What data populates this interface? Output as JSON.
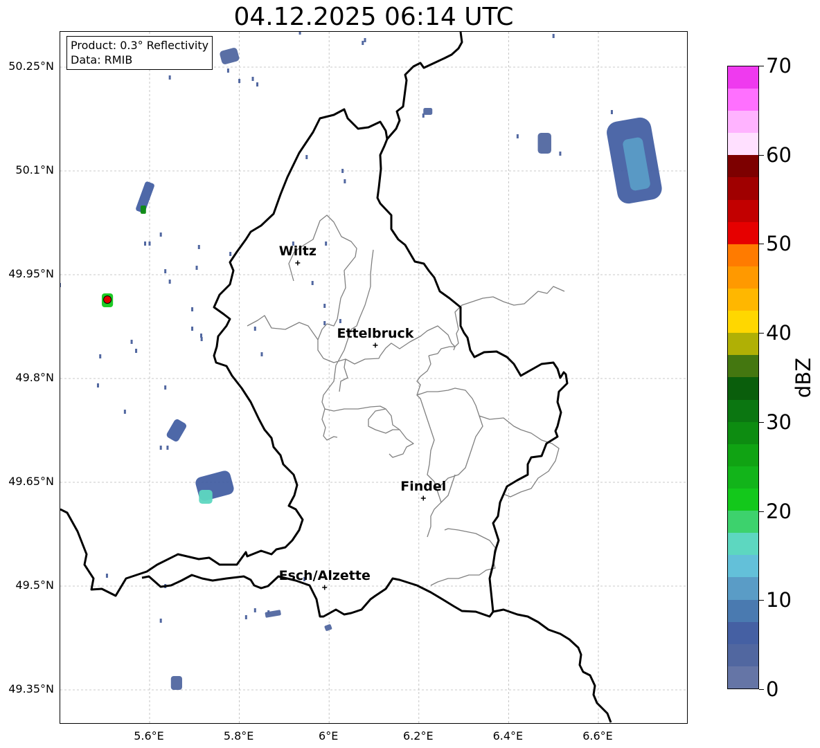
{
  "title": "04.12.2025 06:14 UTC",
  "info": {
    "product": "Product: 0.3° Reflectivity",
    "data": "Data: RMIB"
  },
  "lat_ticks": [
    {
      "value": 50.25,
      "label": "50.25°N"
    },
    {
      "value": 50.1,
      "label": "50.1°N"
    },
    {
      "value": 49.95,
      "label": "49.95°N"
    },
    {
      "value": 49.8,
      "label": "49.8°N"
    },
    {
      "value": 49.65,
      "label": "49.65°N"
    },
    {
      "value": 49.5,
      "label": "49.5°N"
    },
    {
      "value": 49.35,
      "label": "49.35°N"
    }
  ],
  "lon_ticks": [
    {
      "value": 5.6,
      "label": "5.6°E"
    },
    {
      "value": 5.8,
      "label": "5.8°E"
    },
    {
      "value": 6.0,
      "label": "6°E"
    },
    {
      "value": 6.2,
      "label": "6.2°E"
    },
    {
      "value": 6.4,
      "label": "6.4°E"
    },
    {
      "value": 6.6,
      "label": "6.6°E"
    }
  ],
  "cities": [
    {
      "name": "Wiltz",
      "lon": 5.93,
      "lat": 49.967
    },
    {
      "name": "Ettelbruck",
      "lon": 6.103,
      "lat": 49.848
    },
    {
      "name": "Findel",
      "lon": 6.21,
      "lat": 49.627
    },
    {
      "name": "Esch/Alzette",
      "lon": 5.99,
      "lat": 49.498
    }
  ],
  "radar_site": {
    "lon": 5.506,
    "lat": 49.914
  },
  "colorbar": {
    "unit": "dBZ",
    "min": 0,
    "max": 70,
    "ticks": [
      {
        "value": 0,
        "label": "0"
      },
      {
        "value": 10,
        "label": "10"
      },
      {
        "value": 20,
        "label": "20"
      },
      {
        "value": 30,
        "label": "30"
      },
      {
        "value": 40,
        "label": "40"
      },
      {
        "value": 50,
        "label": "50"
      },
      {
        "value": 60,
        "label": "60"
      },
      {
        "value": 70,
        "label": "70"
      }
    ],
    "colors": [
      "#6575a6",
      "#5167a0",
      "#4560a3",
      "#4a7ab0",
      "#5a9cc6",
      "#63c0d9",
      "#5dd7c0",
      "#3dd26d",
      "#13c81b",
      "#12b41a",
      "#10a313",
      "#0d8c11",
      "#0b7611",
      "#0a5e0c",
      "#447710",
      "#b0b005",
      "#ffd700",
      "#ffb700",
      "#ff9900",
      "#ff7b00",
      "#e60000",
      "#c20000",
      "#a00000",
      "#7d0000",
      "#ffe0ff",
      "#ffb3ff",
      "#ff70ff",
      "#ef3aef"
    ]
  },
  "echoes": [
    {
      "lon": 6.68,
      "lat": 50.115,
      "w": 0.1,
      "h": 0.12,
      "rot": -10,
      "dbz": 6
    },
    {
      "lon": 6.685,
      "lat": 50.11,
      "w": 0.045,
      "h": 0.075,
      "rot": -10,
      "dbz": 12
    },
    {
      "lon": 6.48,
      "lat": 50.14,
      "w": 0.03,
      "h": 0.03,
      "rot": 0,
      "dbz": 3
    },
    {
      "lon": 5.778,
      "lat": 50.266,
      "w": 0.04,
      "h": 0.02,
      "rot": -15,
      "dbz": 3
    },
    {
      "lon": 5.59,
      "lat": 50.062,
      "w": 0.022,
      "h": 0.045,
      "rot": 20,
      "dbz": 6
    },
    {
      "lon": 5.586,
      "lat": 50.044,
      "w": 0.012,
      "h": 0.012,
      "rot": 0,
      "dbz": 28
    },
    {
      "lon": 5.506,
      "lat": 49.913,
      "w": 0.025,
      "h": 0.02,
      "rot": 0,
      "dbz": 20
    },
    {
      "lon": 5.66,
      "lat": 49.725,
      "w": 0.03,
      "h": 0.03,
      "rot": 30,
      "dbz": 5
    },
    {
      "lon": 5.745,
      "lat": 49.645,
      "w": 0.08,
      "h": 0.035,
      "rot": -15,
      "dbz": 6
    },
    {
      "lon": 5.725,
      "lat": 49.629,
      "w": 0.03,
      "h": 0.02,
      "rot": 0,
      "dbz": 17
    },
    {
      "lon": 5.66,
      "lat": 49.36,
      "w": 0.025,
      "h": 0.02,
      "rot": 0,
      "dbz": 4
    },
    {
      "lon": 6.22,
      "lat": 50.186,
      "w": 0.02,
      "h": 0.01,
      "rot": 0,
      "dbz": 3
    },
    {
      "lon": 5.875,
      "lat": 49.46,
      "w": 0.035,
      "h": 0.008,
      "rot": -10,
      "dbz": 3
    },
    {
      "lon": 5.998,
      "lat": 49.44,
      "w": 0.015,
      "h": 0.008,
      "rot": -20,
      "dbz": 3
    }
  ],
  "speckles": [
    [
      5.8,
      50.23
    ],
    [
      5.84,
      50.225
    ],
    [
      5.775,
      50.245
    ],
    [
      5.83,
      50.233
    ],
    [
      5.645,
      50.235
    ],
    [
      6.21,
      50.18
    ],
    [
      6.63,
      50.185
    ],
    [
      6.42,
      50.15
    ],
    [
      6.515,
      50.125
    ],
    [
      5.95,
      50.12
    ],
    [
      6.03,
      50.1
    ],
    [
      6.035,
      50.085
    ],
    [
      5.625,
      50.008
    ],
    [
      5.59,
      49.995
    ],
    [
      5.6,
      49.995
    ],
    [
      5.71,
      49.99
    ],
    [
      5.78,
      49.98
    ],
    [
      5.92,
      49.995
    ],
    [
      5.705,
      49.96
    ],
    [
      5.635,
      49.955
    ],
    [
      5.645,
      49.94
    ],
    [
      5.695,
      49.9
    ],
    [
      5.695,
      49.872
    ],
    [
      5.4,
      49.935
    ],
    [
      5.56,
      49.853
    ],
    [
      5.57,
      49.84
    ],
    [
      5.49,
      49.832
    ],
    [
      5.485,
      49.79
    ],
    [
      5.715,
      49.862
    ],
    [
      5.716,
      49.857
    ],
    [
      5.85,
      49.835
    ],
    [
      5.835,
      49.872
    ],
    [
      5.545,
      49.752
    ],
    [
      5.635,
      49.787
    ],
    [
      5.625,
      49.7
    ],
    [
      5.64,
      49.7
    ],
    [
      5.963,
      49.938
    ],
    [
      5.99,
      49.905
    ],
    [
      5.99,
      49.88
    ],
    [
      6.025,
      49.883
    ],
    [
      5.993,
      49.995
    ],
    [
      5.505,
      49.515
    ],
    [
      5.635,
      49.5
    ],
    [
      5.625,
      49.45
    ],
    [
      5.815,
      49.455
    ],
    [
      5.835,
      49.465
    ],
    [
      5.865,
      49.462
    ],
    [
      5.945,
      49.51
    ],
    [
      6.5,
      50.295
    ],
    [
      5.935,
      50.3
    ],
    [
      6.08,
      50.289
    ],
    [
      6.075,
      50.285
    ]
  ]
}
